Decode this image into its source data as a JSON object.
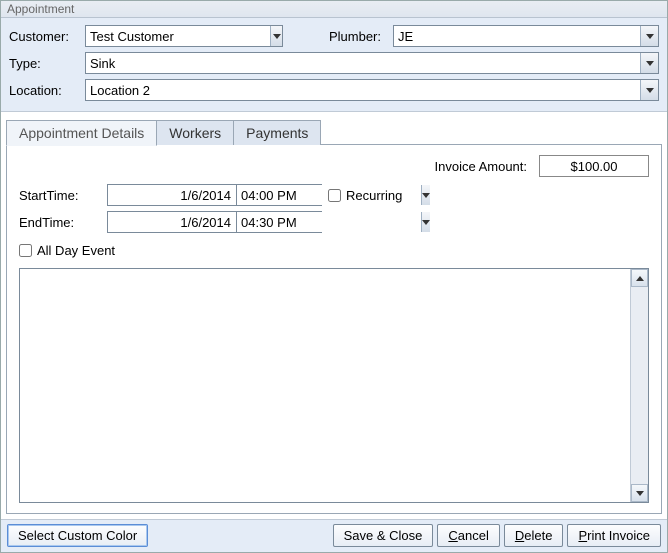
{
  "window": {
    "title": "Appointment"
  },
  "header": {
    "customer": {
      "label": "Customer:",
      "value": "Test Customer"
    },
    "plumber": {
      "label": "Plumber:",
      "value": "JE"
    },
    "type": {
      "label": "Type:",
      "value": "Sink"
    },
    "location": {
      "label": "Location:",
      "value": "Location 2"
    }
  },
  "tabs": {
    "details": {
      "label": "Appointment Details",
      "active": true
    },
    "workers": {
      "label": "Workers",
      "active": false
    },
    "payments": {
      "label": "Payments",
      "active": false
    }
  },
  "details": {
    "invoice_label": "Invoice Amount:",
    "invoice_value": "$100.00",
    "start_label": "StartTime:",
    "start_date": "1/6/2014",
    "start_time": "04:00 PM",
    "end_label": "EndTime:",
    "end_date": "1/6/2014",
    "end_time": "04:30 PM",
    "recurring_label": "Recurring",
    "recurring_checked": false,
    "allday_label": "All Day Event",
    "allday_checked": false,
    "listbox_text": ""
  },
  "actions": {
    "custom_color": "Select Custom Color",
    "save": "Save & Close",
    "cancel": "Cancel",
    "delete": "Delete",
    "print": "Print Invoice"
  }
}
